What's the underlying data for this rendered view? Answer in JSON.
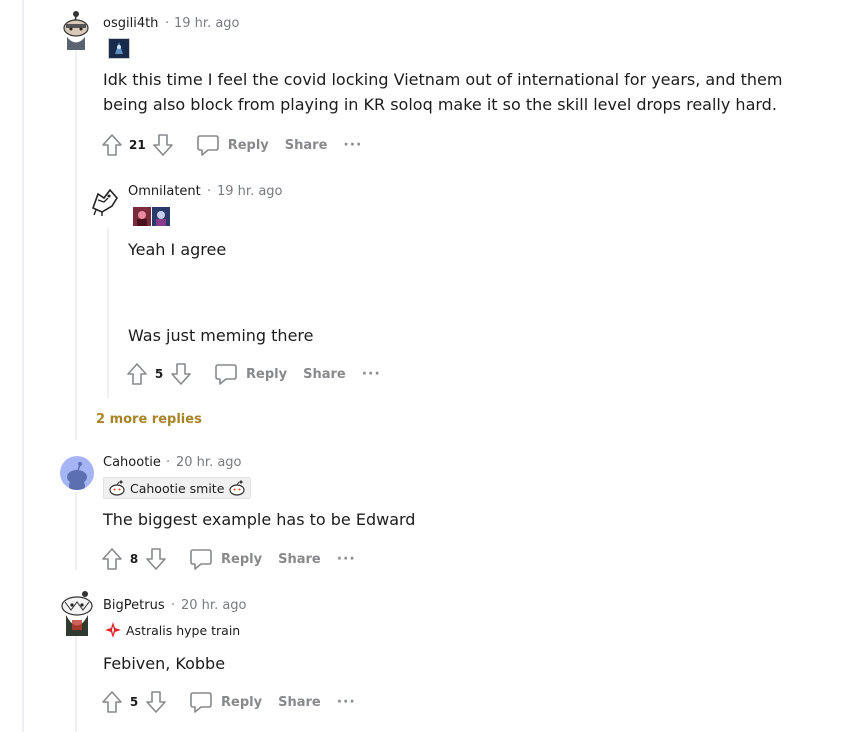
{
  "comments": [
    {
      "username": "osgili4th",
      "time": "19 hr. ago",
      "body": "Idk this time I feel the covid locking Vietnam out of international for years, and them being also block from playing in KR soloq make it so the skill level drops really hard.",
      "votes": "21"
    },
    {
      "username": "Omnilatent",
      "time": "19 hr. ago",
      "body_line1": "Yeah I agree",
      "body_line2": "Was just meming there",
      "votes": "5"
    },
    {
      "username": "Cahootie",
      "time": "20 hr. ago",
      "flair": "Cahootie smite",
      "body": "The biggest example has to be Edward",
      "votes": "8"
    },
    {
      "username": "BigPetrus",
      "time": "20 hr. ago",
      "flair": "Astralis hype train",
      "body": "Febiven, Kobbe",
      "votes": "5"
    }
  ],
  "actions": {
    "reply": "Reply",
    "share": "Share",
    "more": "···"
  },
  "separator": "·",
  "more_replies": "2 more replies",
  "colors": {
    "muted": "#878a8c",
    "link": "#a88428",
    "thread": "#edeff1"
  }
}
